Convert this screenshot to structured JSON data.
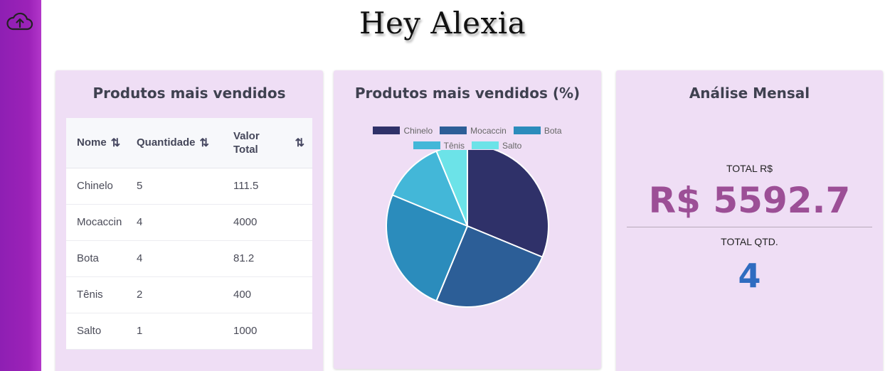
{
  "greeting": "Hey Alexia",
  "sidebar": {
    "upload_icon": "cloud-upload-icon"
  },
  "products_table": {
    "title": "Produtos mais vendidos",
    "columns": {
      "name": "Nome",
      "quantity": "Quantidade",
      "value_line1": "Valor",
      "value_line2": "Total"
    },
    "sort_icon": "⇅",
    "rows": [
      {
        "name": "Chinelo",
        "quantity": "5",
        "value": "111.5"
      },
      {
        "name": "Mocaccin",
        "quantity": "4",
        "value": "4000"
      },
      {
        "name": "Bota",
        "quantity": "4",
        "value": "81.2"
      },
      {
        "name": "Tênis",
        "quantity": "2",
        "value": "400"
      },
      {
        "name": "Salto",
        "quantity": "1",
        "value": "1000"
      }
    ]
  },
  "pie_card": {
    "title": "Produtos mais vendidos (%)",
    "chart_data": {
      "type": "pie",
      "categories": [
        "Chinelo",
        "Mocaccin",
        "Bota",
        "Tênis",
        "Salto"
      ],
      "values": [
        31.25,
        25,
        25,
        12.5,
        6.25
      ],
      "colors": [
        "#2f3169",
        "#2c5e97",
        "#2b8cbc",
        "#43b7d8",
        "#6ce3e8"
      ],
      "legend_position": "top"
    }
  },
  "monthly": {
    "title": "Análise Mensal",
    "total_value_label": "TOTAL R$",
    "total_value": "R$ 5592.7",
    "total_qty_label": "TOTAL QTD.",
    "total_qty": "4",
    "value_color": "#9c4f96",
    "qty_color": "#2f6cc0"
  }
}
